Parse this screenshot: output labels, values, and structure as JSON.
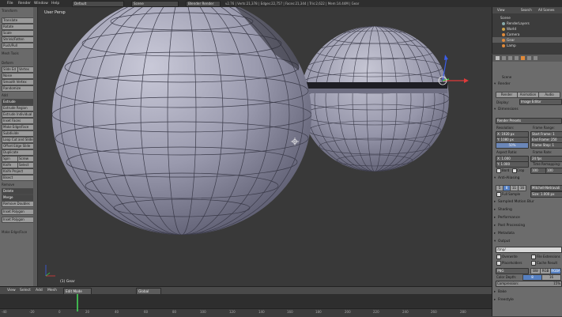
{
  "menu": {
    "file": "File",
    "render": "Render",
    "window": "Window",
    "help": "Help"
  },
  "header": {
    "layout": "Default",
    "scene": "Scene",
    "engine": "Blender Render",
    "stats": "v2.76 | Verts:21,378 | Edges:22,757 | Faces:21,344 | Tris:2,622 | Mem:14.44M | Gear"
  },
  "toolshelf": {
    "section_transform": "Transform",
    "translate": "Translate",
    "rotate": "Rotate",
    "scale": "Scale",
    "shrink": "Shrink/Fatten",
    "pushpull": "Push/Pull",
    "section_mesh": "Mesh Tools",
    "section_deform": "Deform",
    "slide_edge": "Slide Ed",
    "vertex": "Vertex",
    "noise": "Noise",
    "smooth": "Smooth Vertex",
    "randomize": "Randomize",
    "section_add": "Add",
    "extrude": "Extrude",
    "extrude_region": "Extrude Region",
    "extrude_individual": "Extrude Individual",
    "inset": "Inset Faces",
    "make_edge": "Make Edge/Face",
    "subdivide": "Subdivide",
    "loop_cut": "Loop Cut and Slide",
    "offset_edge": "Offset Edge Slide",
    "duplicate": "Duplicate",
    "spin": "Spin",
    "screw": "Screw",
    "knife": "Knife",
    "select": "Select",
    "knife_project": "Knife Project",
    "bisect": "Bisect",
    "section_remove": "Remove",
    "delete": "Delete",
    "merge": "Merge",
    "remove_doubles": "Remove Doubles",
    "inset_polygon": "Inset Polygon",
    "inset_polygon2": "Inset Polygon",
    "footer": "Make Edge/Face"
  },
  "viewport": {
    "label": "User Persp",
    "object": "(1) Gear"
  },
  "vheader": {
    "view": "View",
    "select": "Select",
    "add": "Add",
    "mesh": "Mesh",
    "mode": "Edit Mode",
    "pivot": "Global"
  },
  "timeline": {
    "ticks": [
      "-40",
      "-20",
      "0",
      "20",
      "40",
      "60",
      "80",
      "100",
      "120",
      "140",
      "160",
      "180",
      "200",
      "220",
      "240",
      "260",
      "280"
    ]
  },
  "outliner": {
    "tabs": [
      "View",
      "Search",
      "All Scenes"
    ],
    "rows": [
      "Scene",
      "RenderLayers",
      "World",
      "Camera",
      "Gear",
      "Lamp"
    ]
  },
  "properties": {
    "scene_label": "Scene",
    "render_section": "Render",
    "render_btn": "Render",
    "animation_btn": "Animation",
    "audio_btn": "Audio",
    "display_label": "Display:",
    "display_value": "Image Editor",
    "dimensions": "Dimensions",
    "presets": "Render Presets",
    "resolution": "Resolution:",
    "frame_range": "Frame Range:",
    "res_x": "X: 1920 px",
    "res_y": "Y: 1080 px",
    "res_pct": "50%",
    "start": "Start Frame: 1",
    "end": "End Frame: 250",
    "step": "Frame Step: 1",
    "aspect": "Aspect Ratio:",
    "frame_rate": "Frame Rate:",
    "asp_x": "X: 1.000",
    "asp_y": "Y: 1.000",
    "fps": "24 fps",
    "time_remap": "Time Remapping:",
    "tr_old": "100",
    "tr_new": "100",
    "border": "Bord",
    "crop": "Crop",
    "anti_alias": "Anti-Aliasing",
    "aa_5": "5",
    "aa_8": "8",
    "aa_11": "11",
    "aa_16": "16",
    "filter": "Mitchell-Netravali",
    "full_sample": "Full Sample",
    "size": "Size: 1.000 px",
    "motion_blur": "Sampled Motion Blur",
    "shading": "Shading",
    "performance": "Performance",
    "post": "Post Processing",
    "metadata": "Metadata",
    "output": "Output",
    "output_path": "/tmp/",
    "overwrite": "Overwrite",
    "file_ext": "File Extensions",
    "placeholders": "Placeholders",
    "cache": "Cache Result",
    "format": "PNG",
    "bw": "BW",
    "rgb": "RGB",
    "rgba": "RGBA",
    "color_depth": "Color Depth:",
    "depth8": "8",
    "depth16": "16",
    "compression": "Compression:",
    "comp_val": "15%",
    "bake": "Bake",
    "freestyle": "Freestyle"
  }
}
